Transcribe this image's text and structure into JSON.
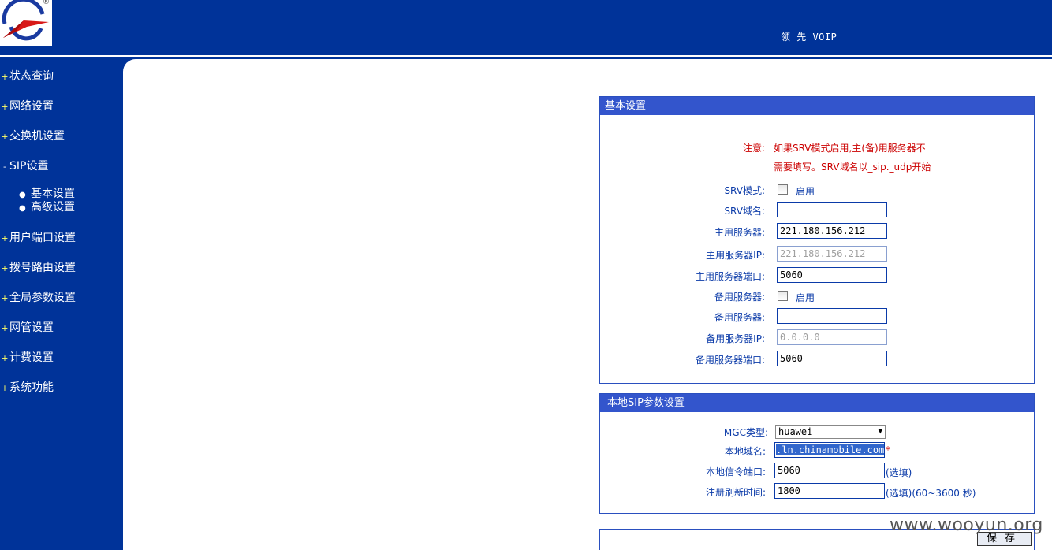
{
  "header": {
    "brand": "领 先 VOIP",
    "reg_mark": "®"
  },
  "sidebar": {
    "items": [
      {
        "bullet": "+",
        "label": "状态查询"
      },
      {
        "bullet": "+",
        "label": "网络设置"
      },
      {
        "bullet": "+",
        "label": "交换机设置"
      },
      {
        "bullet": "-",
        "label": "SIP设置"
      },
      {
        "bullet": "+",
        "label": "用户端口设置"
      },
      {
        "bullet": "+",
        "label": "拨号路由设置"
      },
      {
        "bullet": "+",
        "label": "全局参数设置"
      },
      {
        "bullet": "+",
        "label": "网管设置"
      },
      {
        "bullet": "+",
        "label": "计费设置"
      },
      {
        "bullet": "+",
        "label": "系统功能"
      }
    ],
    "sub_items": [
      {
        "dot": "●",
        "label": "基本设置"
      },
      {
        "dot": "●",
        "label": "高级设置"
      }
    ]
  },
  "basic": {
    "title": "基本设置",
    "note_label": "注意:",
    "note_line1": "如果SRV模式启用,主(备)用服务器不",
    "note_line2": "需要填写。SRV域名以_sip._udp开始",
    "srv_mode_label": "SRV模式:",
    "srv_mode_check_label": "启用",
    "srv_domain_label": "SRV域名:",
    "srv_domain_value": "",
    "primary_server_label": "主用服务器:",
    "primary_server_value": "221.180.156.212",
    "primary_ip_label": "主用服务器IP:",
    "primary_ip_value": "221.180.156.212",
    "primary_port_label": "主用服务器端口:",
    "primary_port_value": "5060",
    "backup_enable_label": "备用服务器:",
    "backup_enable_check_label": "启用",
    "backup_server_label": "备用服务器:",
    "backup_server_value": "",
    "backup_ip_label": "备用服务器IP:",
    "backup_ip_value": "0.0.0.0",
    "backup_port_label": "备用服务器端口:",
    "backup_port_value": "5060"
  },
  "local": {
    "title": "本地SIP参数设置",
    "mgc_label": "MGC类型:",
    "mgc_value": "huawei",
    "domain_label": "本地域名:",
    "domain_value": ".ln.chinamobile.com",
    "domain_required": "*",
    "signal_port_label": "本地信令端口:",
    "signal_port_value": "5060",
    "signal_port_hint": "(选填)",
    "refresh_label": "注册刷新时间:",
    "refresh_value": "1800",
    "refresh_hint": "(选填)(60~3600 秒)"
  },
  "actions": {
    "save_label": "保存"
  },
  "watermark": "www.wooyun.org"
}
